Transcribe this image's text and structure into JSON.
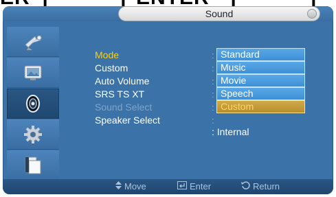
{
  "top_hint": {
    "left_text": "ER",
    "bracket_left": "[",
    "bracket_mid": "]",
    "middle_text": "ENTER",
    "bracket_right": "[",
    "bracket_end": "]"
  },
  "osd": {
    "title": "Sound",
    "sidebar": [
      {
        "icon": "satellite-dish-icon",
        "active": false
      },
      {
        "icon": "picture-icon",
        "active": false
      },
      {
        "icon": "sound-icon",
        "active": true
      },
      {
        "icon": "setup-gear-icon",
        "active": false
      },
      {
        "icon": "multi-window-icon",
        "active": false
      }
    ],
    "menu": [
      {
        "label": "Mode",
        "state": "selected"
      },
      {
        "label": "Custom",
        "state": "normal"
      },
      {
        "label": "Auto Volume",
        "state": "normal"
      },
      {
        "label": "SRS TS XT",
        "state": "normal"
      },
      {
        "label": "Sound Select",
        "state": "disabled"
      },
      {
        "label": "Speaker Select",
        "state": "normal"
      }
    ],
    "colon": ":",
    "options": [
      {
        "label": "Standard",
        "focused": false
      },
      {
        "label": "Music",
        "focused": false
      },
      {
        "label": "Movie",
        "focused": false
      },
      {
        "label": "Speech",
        "focused": false
      },
      {
        "label": "Custom",
        "focused": true
      }
    ],
    "speaker_value": "Internal",
    "bottom": {
      "move": "Move",
      "enter": "Enter",
      "return": "Return"
    }
  },
  "colors": {
    "panel": "#3b73a9",
    "selected_text": "#ffd000",
    "option_bg": "#4a9ce0",
    "focused_option": "#c09a3a"
  }
}
